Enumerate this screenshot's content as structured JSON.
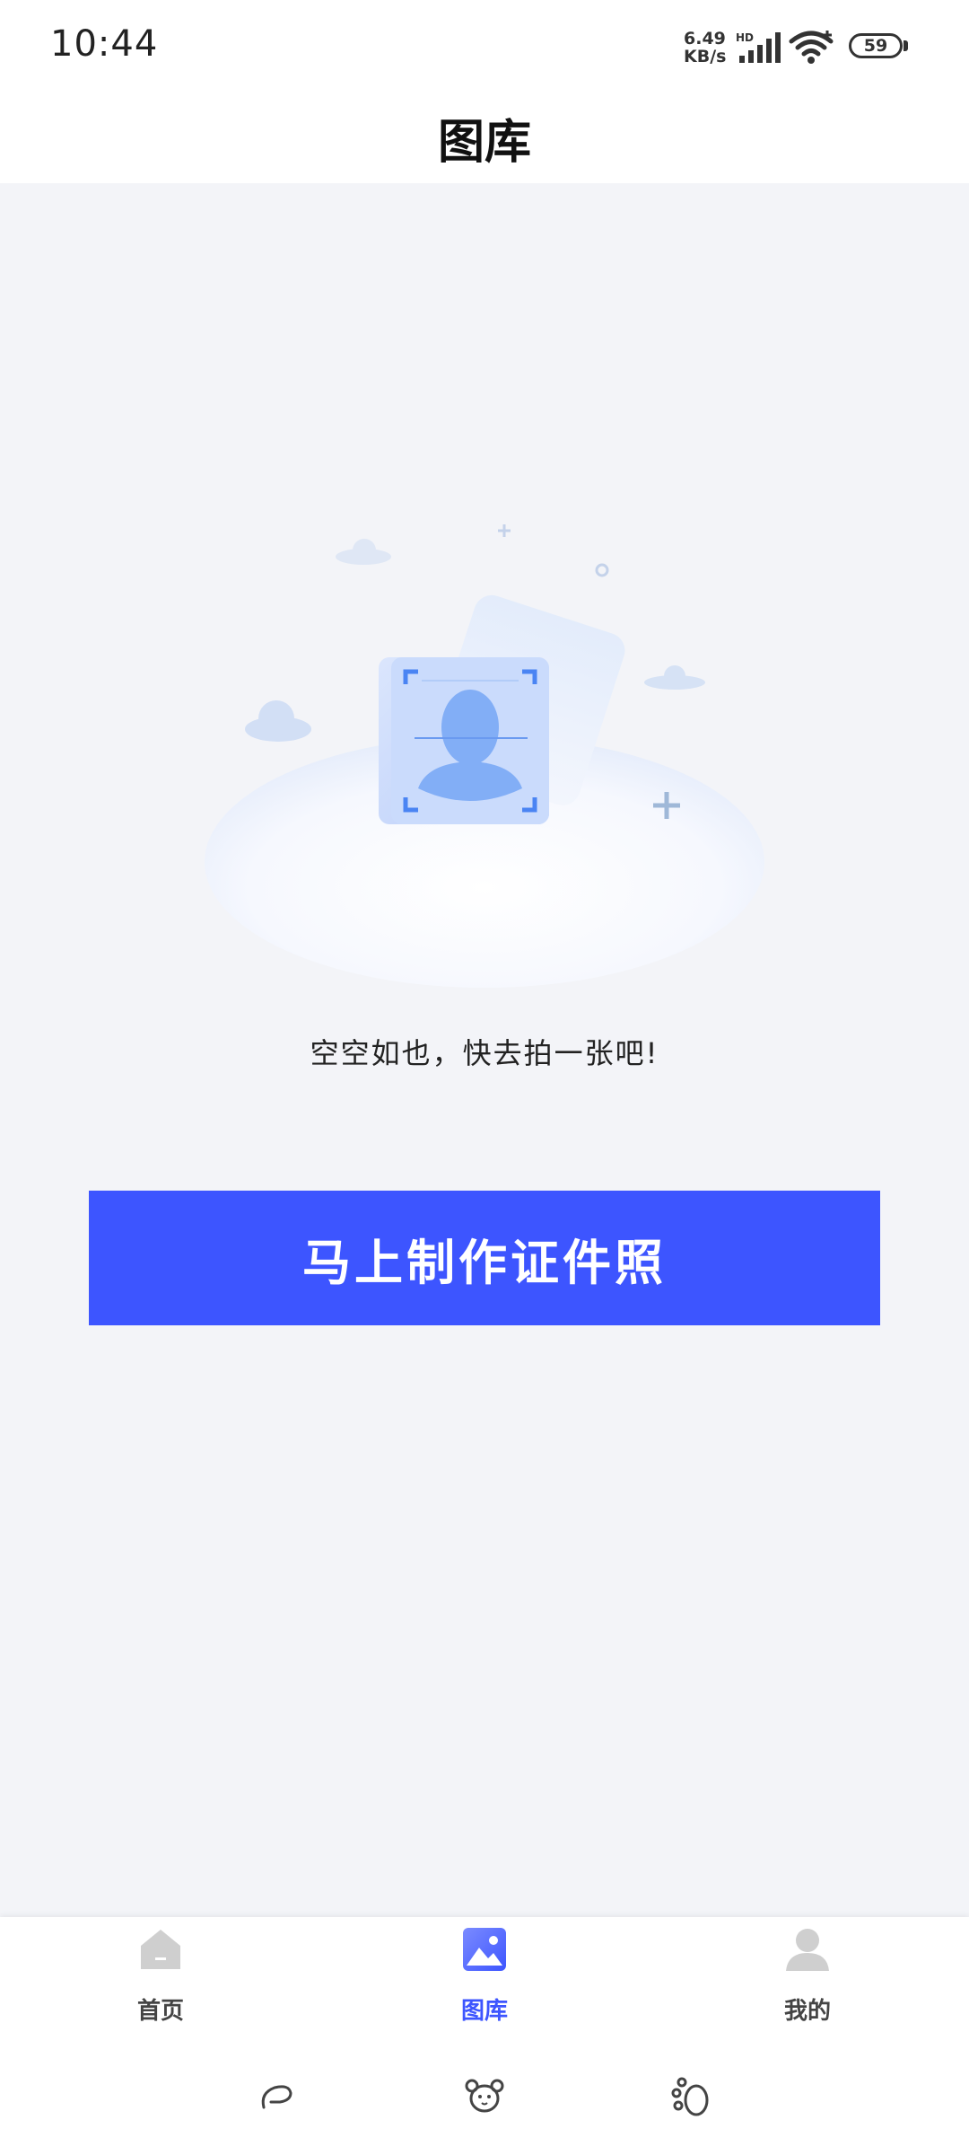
{
  "status_bar": {
    "time": "10:44",
    "net_speed_value": "6.49",
    "net_speed_unit": "KB/s",
    "signal_label": "HD",
    "battery": "59"
  },
  "header": {
    "title": "图库"
  },
  "empty_state": {
    "message": "空空如也，快去拍一张吧!",
    "button_label": "马上制作证件照"
  },
  "bottom_nav": {
    "items": [
      {
        "label": "首页",
        "icon": "home-icon",
        "active": false
      },
      {
        "label": "图库",
        "icon": "gallery-icon",
        "active": true
      },
      {
        "label": "我的",
        "icon": "profile-icon",
        "active": false
      }
    ]
  },
  "colors": {
    "accent": "#3d55ff",
    "background": "#f3f4f8",
    "inactive_icon": "#cccccc"
  }
}
